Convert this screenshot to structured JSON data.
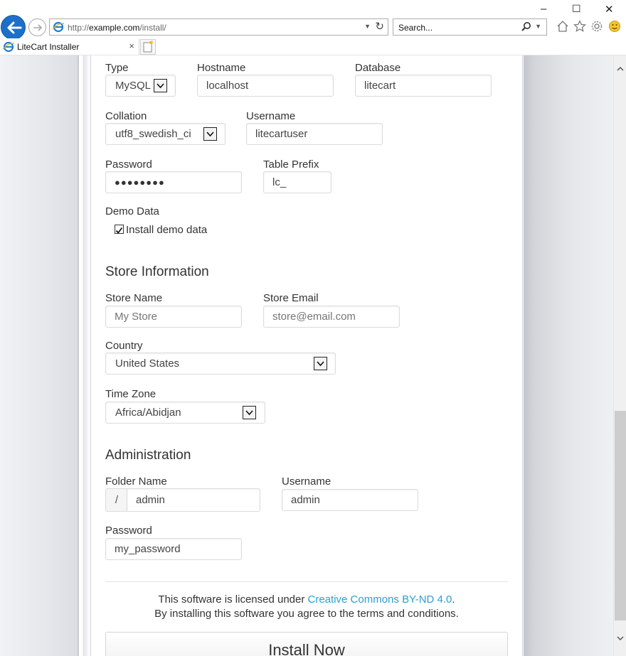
{
  "browser": {
    "url_prefix": "http://",
    "url_host": "example.com",
    "url_path": "/install/",
    "search_placeholder": "Search...",
    "tab_title": "LiteCart Installer",
    "tab_close": "×",
    "minimize": "–",
    "maximize": "☐",
    "close": "✕"
  },
  "database": {
    "type_label": "Type",
    "type_value": "MySQL",
    "hostname_label": "Hostname",
    "hostname_value": "localhost",
    "database_label": "Database",
    "database_value": "litecart",
    "collation_label": "Collation",
    "collation_value": "utf8_swedish_ci",
    "username_label": "Username",
    "username_value": "litecartuser",
    "password_label": "Password",
    "password_value": "●●●●●●●●",
    "prefix_label": "Table Prefix",
    "prefix_value": "lc_",
    "demo_label": "Demo Data",
    "demo_checkbox_label": "Install demo data",
    "demo_checked": true
  },
  "store": {
    "heading": "Store Information",
    "name_label": "Store Name",
    "name_placeholder": "My Store",
    "email_label": "Store Email",
    "email_placeholder": "store@email.com",
    "country_label": "Country",
    "country_value": "United States",
    "timezone_label": "Time Zone",
    "timezone_value": "Africa/Abidjan"
  },
  "admin": {
    "heading": "Administration",
    "folder_label": "Folder Name",
    "folder_prefix": "/",
    "folder_value": "admin",
    "username_label": "Username",
    "username_value": "admin",
    "password_label": "Password",
    "password_value": "my_password"
  },
  "footer": {
    "license_text": "This software is licensed under ",
    "license_link": "Creative Commons BY-ND 4.0",
    "license_end": ".",
    "terms_text": "By installing this software you agree to the terms and conditions."
  },
  "install_button": "Install Now",
  "colors": {
    "link": "#2a9fd6",
    "back_button": "#1e6fc8"
  }
}
